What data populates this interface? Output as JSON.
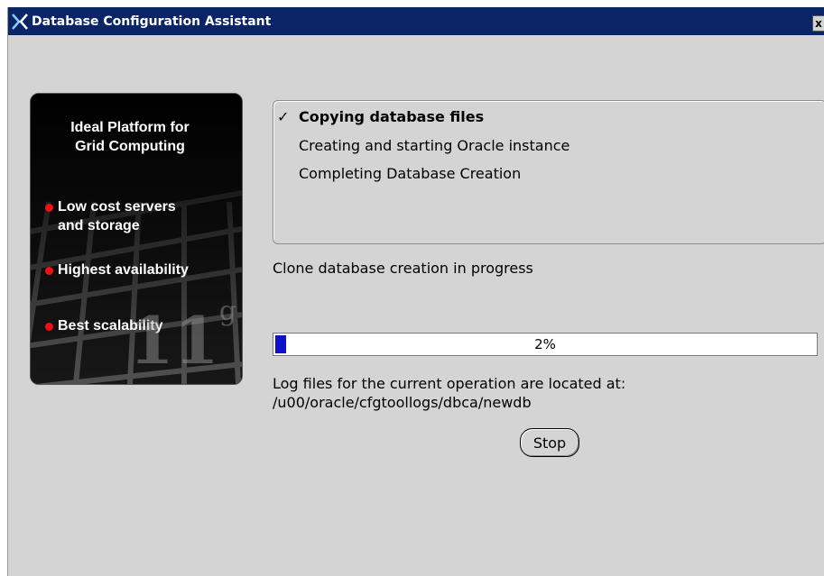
{
  "window": {
    "title": "Database Configuration Assistant",
    "close_glyph": "x"
  },
  "promo": {
    "title_line1": "Ideal Platform for",
    "title_line2": "Grid Computing",
    "items": [
      {
        "line1": "Low cost servers",
        "line2": "and storage"
      },
      {
        "line1": "Highest availability",
        "line2": ""
      },
      {
        "line1": "Best scalability",
        "line2": ""
      }
    ],
    "logo_number": "11",
    "logo_letter": "g",
    "bullet_color": "#ee1111"
  },
  "steps": [
    {
      "label": "Copying database files",
      "status": "done",
      "check": "✓"
    },
    {
      "label": "Creating and starting Oracle instance",
      "status": "pending"
    },
    {
      "label": "Completing Database Creation",
      "status": "pending"
    }
  ],
  "status_text": "Clone database creation in progress",
  "progress": {
    "percent": 2,
    "label": "2%",
    "fill_color": "#1010cc"
  },
  "log": {
    "line1": "Log files for the current operation are located at:",
    "line2": "/u00/oracle/cfgtoollogs/dbca/newdb"
  },
  "buttons": {
    "stop": "Stop"
  },
  "colors": {
    "titlebar": "#0a2466",
    "background": "#d4d4d4"
  }
}
